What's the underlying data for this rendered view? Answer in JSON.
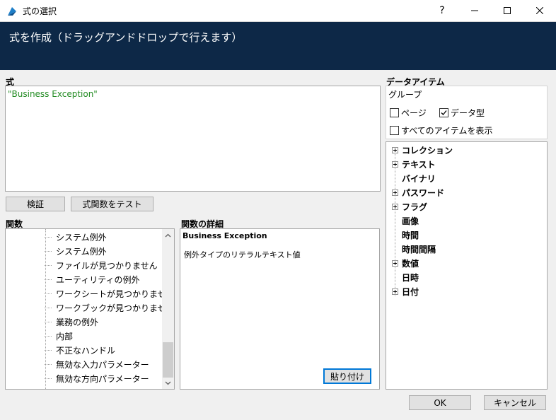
{
  "window": {
    "title": "式の選択",
    "help_label": "?"
  },
  "banner": {
    "text": "式を作成（ドラッグアンドドロップで行えます）"
  },
  "formula": {
    "label": "式",
    "value": "\"Business Exception\""
  },
  "buttons": {
    "validate": "検証",
    "test_functions": "式関数をテスト",
    "paste": "貼り付け",
    "ok": "OK",
    "cancel": "キャンセル"
  },
  "functions": {
    "label": "関数",
    "items": [
      "システム例外",
      "システム例外",
      "ファイルが見つかりません",
      "ユーティリティの例外",
      "ワークシートが見つかりません",
      "ワークブックが見つかりません",
      "業務の例外",
      "内部",
      "不正なハンドル",
      "無効な入力パラメーター",
      "無効な方向パラメーター"
    ]
  },
  "function_details": {
    "label": "関数の詳細",
    "name": "Business Exception",
    "description": "例外タイプのリテラルテキスト値"
  },
  "data_items": {
    "label": "データアイテム",
    "group_label": "グループ",
    "checkboxes": {
      "page": {
        "label": "ページ",
        "checked": false
      },
      "data_type": {
        "label": "データ型",
        "checked": true
      },
      "show_all": {
        "label": "すべてのアイテムを表示",
        "checked": false
      }
    },
    "tree": [
      {
        "label": "コレクション",
        "expandable": true
      },
      {
        "label": "テキスト",
        "expandable": true
      },
      {
        "label": "バイナリ",
        "expandable": false
      },
      {
        "label": "パスワード",
        "expandable": true
      },
      {
        "label": "フラグ",
        "expandable": true
      },
      {
        "label": "画像",
        "expandable": false
      },
      {
        "label": "時間",
        "expandable": false
      },
      {
        "label": "時間間隔",
        "expandable": false
      },
      {
        "label": "数値",
        "expandable": true
      },
      {
        "label": "日時",
        "expandable": false
      },
      {
        "label": "日付",
        "expandable": true
      }
    ]
  },
  "colors": {
    "banner_bg": "#0d2847",
    "formula_text": "#228b22",
    "focus_border": "#0078d7"
  }
}
